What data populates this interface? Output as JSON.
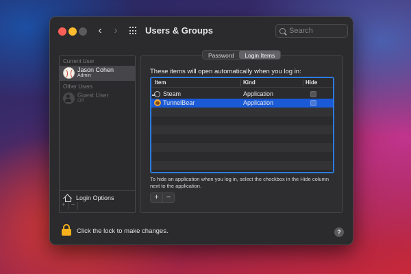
{
  "window": {
    "title": "Users & Groups",
    "nav_back": "‹",
    "nav_forward": "›"
  },
  "search": {
    "placeholder": "Search",
    "value": ""
  },
  "sidebar": {
    "current_user_label": "Current User",
    "other_users_label": "Other Users",
    "users": [
      {
        "name": "Jason Cohen",
        "role": "Admin",
        "avatar": "baseball-icon",
        "selected": true
      },
      {
        "name": "Guest User",
        "role": "Off",
        "avatar": "person-icon",
        "selected": false
      }
    ],
    "login_options_label": "Login Options",
    "add_label": "+",
    "remove_label": "−"
  },
  "tabs": [
    {
      "label": "Password",
      "active": false
    },
    {
      "label": "Login Items",
      "active": true
    }
  ],
  "login_items": {
    "intro": "These items will open automatically when you log in:",
    "columns": {
      "item": "Item",
      "kind": "Kind",
      "hide": "Hide"
    },
    "rows": [
      {
        "item": "Steam",
        "kind": "Application",
        "icon": "steam-icon",
        "hide": false,
        "selected": false
      },
      {
        "item": "TunnelBear",
        "kind": "Application",
        "icon": "tunnelbear-icon",
        "hide": false,
        "selected": true
      }
    ],
    "hint": "To hide an application when you log in, select the checkbox in the Hide column next to the application.",
    "add_label": "+",
    "remove_label": "−"
  },
  "footer": {
    "lock_text": "Click the lock to make changes.",
    "help_label": "?"
  },
  "colors": {
    "accent": "#2d7be0",
    "selection": "#1a5ad7",
    "lock": "#f6b11c",
    "close": "#fe5f57",
    "minimize": "#febc2e"
  }
}
